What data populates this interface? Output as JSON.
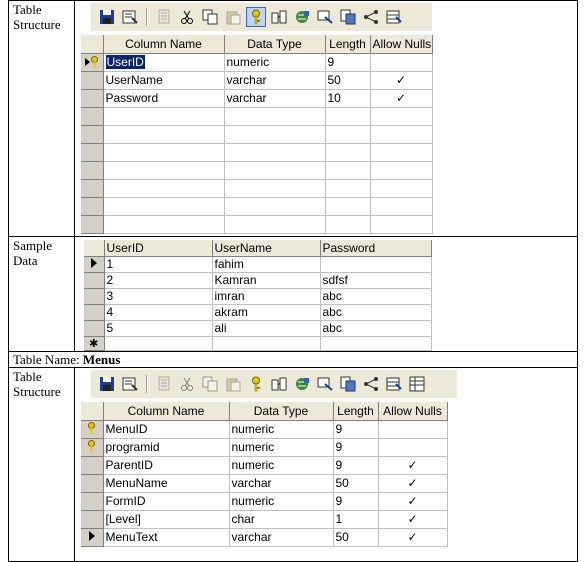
{
  "doc": {
    "label_table_structure": "Table\nStructure",
    "label_sample_data": "Sample\nData",
    "table_name_prefix": "Table Name: ",
    "table_name": "Menus"
  },
  "users_structure": {
    "columns": [
      "Column Name",
      "Data Type",
      "Length",
      "Allow Nulls"
    ],
    "rows": [
      {
        "name": "UserID",
        "type": "numeric",
        "length": "9",
        "nulls": ""
      },
      {
        "name": "UserName",
        "type": "varchar",
        "length": "50",
        "nulls": "✓"
      },
      {
        "name": "Password",
        "type": "varchar",
        "length": "10",
        "nulls": "✓"
      }
    ]
  },
  "users_sample": {
    "columns": [
      "UserID",
      "UserName",
      "Password"
    ],
    "rows": [
      {
        "id": "1",
        "name": "fahim",
        "pw": ""
      },
      {
        "id": "2",
        "name": "Kamran",
        "pw": "sdfsf"
      },
      {
        "id": "3",
        "name": "imran",
        "pw": "abc"
      },
      {
        "id": "4",
        "name": "akram",
        "pw": "abc"
      },
      {
        "id": "5",
        "name": "ali",
        "pw": "abc"
      }
    ],
    "new_row_marker": "✱"
  },
  "menus_structure": {
    "columns": [
      "Column Name",
      "Data Type",
      "Length",
      "Allow Nulls"
    ],
    "rows": [
      {
        "name": "MenuID",
        "type": "numeric",
        "length": "9",
        "nulls": ""
      },
      {
        "name": "programid",
        "type": "numeric",
        "length": "9",
        "nulls": ""
      },
      {
        "name": "ParentID",
        "type": "numeric",
        "length": "9",
        "nulls": "✓"
      },
      {
        "name": "MenuName",
        "type": "varchar",
        "length": "50",
        "nulls": "✓"
      },
      {
        "name": "FormID",
        "type": "numeric",
        "length": "9",
        "nulls": "✓"
      },
      {
        "name": "[Level]",
        "type": "char",
        "length": "1",
        "nulls": "✓"
      },
      {
        "name": "MenuText",
        "type": "varchar",
        "length": "50",
        "nulls": "✓"
      }
    ]
  },
  "toolbar": {
    "icons": [
      "save-icon",
      "properties-icon",
      "generate-script-icon",
      "cut-icon",
      "copy-icon",
      "paste-icon",
      "primary-key-icon",
      "manage-relationships-icon",
      "manage-indexes-icon",
      "manage-constraints-icon",
      "new-relationship-icon",
      "manage-checks-icon",
      "table-view-icon"
    ]
  },
  "colors": {
    "toolbar_bg": "#ece9d8",
    "header_bg": "#ece9d8",
    "selection": "#0a246a",
    "key": "#d8b400"
  }
}
